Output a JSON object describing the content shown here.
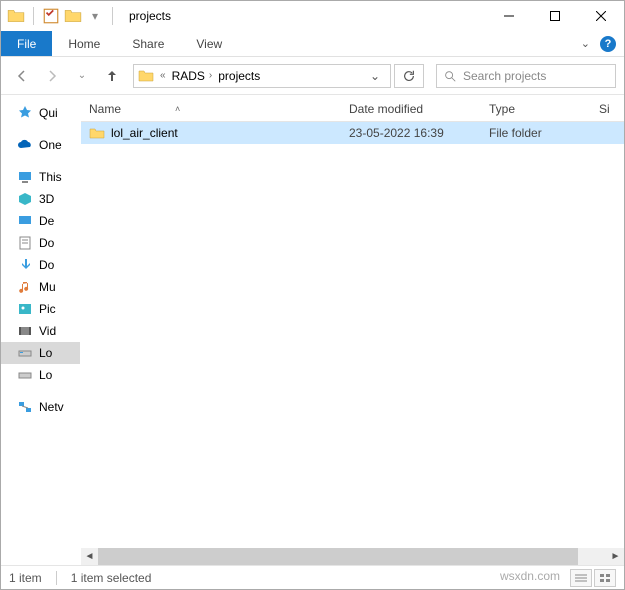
{
  "window": {
    "title": "projects"
  },
  "ribbon": {
    "file": "File",
    "tabs": [
      "Home",
      "Share",
      "View"
    ]
  },
  "nav": {
    "crumbs": [
      "RADS",
      "projects"
    ],
    "search_placeholder": "Search projects"
  },
  "columns": {
    "name": "Name",
    "date": "Date modified",
    "type": "Type",
    "size": "Si"
  },
  "rows": [
    {
      "name": "lol_air_client",
      "date": "23-05-2022 16:39",
      "type": "File folder"
    }
  ],
  "tree": {
    "quick": "Qui",
    "one": "One",
    "this": "This",
    "d3": "3D",
    "de": "De",
    "do1": "Do",
    "do2": "Do",
    "mu": "Mu",
    "pic": "Pic",
    "vid": "Vid",
    "lo1": "Lo",
    "lo2": "Lo",
    "net": "Netv"
  },
  "status": {
    "count": "1 item",
    "selection": "1 item selected"
  },
  "watermark": "wsxdn.com"
}
